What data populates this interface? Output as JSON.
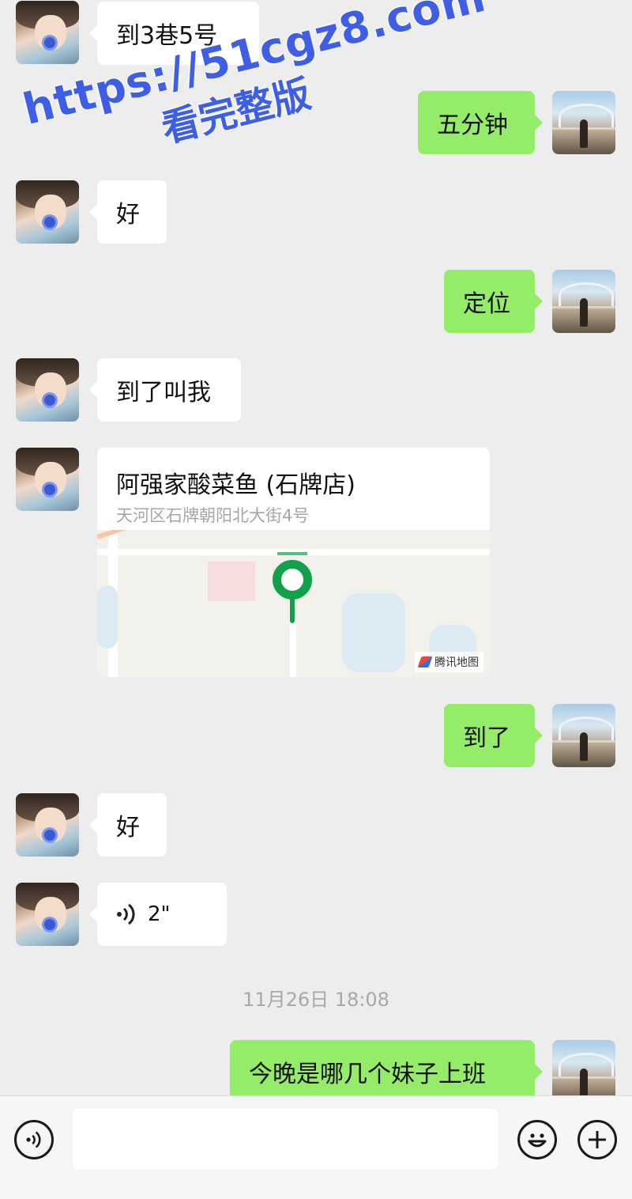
{
  "chat": {
    "messages": [
      {
        "side": "left",
        "text": "到3巷5号"
      },
      {
        "side": "right",
        "text": "五分钟"
      },
      {
        "side": "left",
        "text": "好"
      },
      {
        "side": "right",
        "text": "定位"
      },
      {
        "side": "left",
        "text": "到了叫我"
      },
      {
        "side": "left",
        "type": "location",
        "name": "阿强家酸菜鱼 (石牌店)",
        "address": "天河区石牌朝阳北大街4号",
        "map_provider": "腾讯地图"
      },
      {
        "side": "right",
        "text": "到了"
      },
      {
        "side": "left",
        "text": "好"
      },
      {
        "side": "left",
        "type": "voice",
        "duration": "2\""
      },
      {
        "side": "right",
        "text": "今晚是哪几个妹子上班"
      }
    ],
    "timestamp": "11月26日 18:08"
  },
  "watermark": {
    "line1": "https://51cgz8.com",
    "line2": "看完整版"
  },
  "input_bar": {
    "value": "",
    "icons": [
      "voice-mode-icon",
      "emoji-icon",
      "plus-icon"
    ]
  },
  "colors": {
    "background": "#ededed",
    "self_bubble": "#95ec69",
    "other_bubble": "#ffffff",
    "map_pin": "#12a04a",
    "watermark": "#3f5ee6"
  }
}
